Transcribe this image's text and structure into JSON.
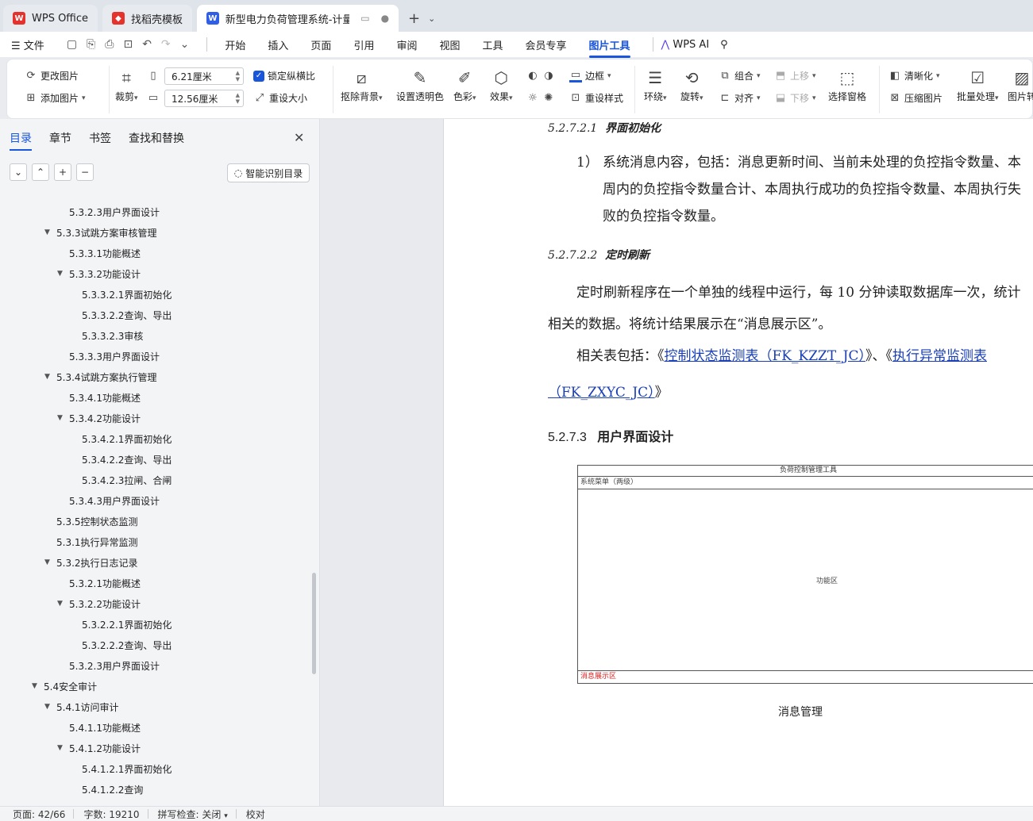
{
  "tabs": [
    {
      "label": "WPS Office",
      "icon": "wps-logo-icon",
      "color": "#e5322d"
    },
    {
      "label": "找稻壳模板",
      "icon": "docer-logo-icon",
      "color": "#e5322d"
    },
    {
      "label": "新型电力负荷管理系统-计量部",
      "icon": "wps-writer-icon",
      "color": "#2f5fe6",
      "active": true
    }
  ],
  "menu": {
    "file": "文件",
    "items": [
      "开始",
      "插入",
      "页面",
      "引用",
      "审阅",
      "视图",
      "工具",
      "会员专享",
      "图片工具"
    ],
    "active": "图片工具",
    "wps_ai": "WPS AI"
  },
  "ribbon": {
    "change_image": "更改图片",
    "add_image": "添加图片",
    "crop": "裁剪",
    "width_value": "6.21厘米",
    "height_value": "12.56厘米",
    "lock_ratio": "锁定纵横比",
    "resize": "重设大小",
    "remove_bg": "抠除背景",
    "set_transparent": "设置透明色",
    "color": "色彩",
    "effect": "效果",
    "border": "边框",
    "reset_style": "重设样式",
    "wrap": "环绕",
    "rotate": "旋转",
    "group": "组合",
    "align": "对齐",
    "move_up": "上移",
    "move_down": "下移",
    "select_pane": "选择窗格",
    "sharpen": "清晰化",
    "compress": "压缩图片",
    "batch": "批量处理",
    "image_more": "图片转"
  },
  "left_panel": {
    "tabs": [
      "目录",
      "章节",
      "书签",
      "查找和替换"
    ],
    "active_tab": "目录",
    "ai_toc": "智能识别目录",
    "toc": [
      {
        "label": "5.3.2.3用户界面设计",
        "level": 2,
        "arrow": false
      },
      {
        "label": "5.3.3试跳方案审核管理",
        "level": 1,
        "arrow": true
      },
      {
        "label": "5.3.3.1功能概述",
        "level": 2,
        "arrow": false
      },
      {
        "label": "5.3.3.2功能设计",
        "level": 2,
        "arrow": true
      },
      {
        "label": "5.3.3.2.1界面初始化",
        "level": 3,
        "arrow": false
      },
      {
        "label": "5.3.3.2.2查询、导出",
        "level": 3,
        "arrow": false
      },
      {
        "label": "5.3.3.2.3审核",
        "level": 3,
        "arrow": false
      },
      {
        "label": "5.3.3.3用户界面设计",
        "level": 2,
        "arrow": false
      },
      {
        "label": "5.3.4试跳方案执行管理",
        "level": 1,
        "arrow": true
      },
      {
        "label": "5.3.4.1功能概述",
        "level": 2,
        "arrow": false
      },
      {
        "label": "5.3.4.2功能设计",
        "level": 2,
        "arrow": true
      },
      {
        "label": "5.3.4.2.1界面初始化",
        "level": 3,
        "arrow": false
      },
      {
        "label": "5.3.4.2.2查询、导出",
        "level": 3,
        "arrow": false
      },
      {
        "label": "5.3.4.2.3拉闸、合闸",
        "level": 3,
        "arrow": false
      },
      {
        "label": "5.3.4.3用户界面设计",
        "level": 2,
        "arrow": false
      },
      {
        "label": "5.3.5控制状态监测",
        "level": 1,
        "arrow": false
      },
      {
        "label": "5.3.1执行异常监测",
        "level": 1,
        "arrow": false
      },
      {
        "label": "5.3.2执行日志记录",
        "level": 1,
        "arrow": true
      },
      {
        "label": "5.3.2.1功能概述",
        "level": 2,
        "arrow": false
      },
      {
        "label": "5.3.2.2功能设计",
        "level": 2,
        "arrow": true
      },
      {
        "label": "5.3.2.2.1界面初始化",
        "level": 3,
        "arrow": false
      },
      {
        "label": "5.3.2.2.2查询、导出",
        "level": 3,
        "arrow": false
      },
      {
        "label": "5.3.2.3用户界面设计",
        "level": 2,
        "arrow": false
      },
      {
        "label": "5.4安全审计",
        "level": 0,
        "arrow": true
      },
      {
        "label": "5.4.1访问审计",
        "level": 1,
        "arrow": true
      },
      {
        "label": "5.4.1.1功能概述",
        "level": 2,
        "arrow": false
      },
      {
        "label": "5.4.1.2功能设计",
        "level": 2,
        "arrow": true
      },
      {
        "label": "5.4.1.2.1界面初始化",
        "level": 3,
        "arrow": false
      },
      {
        "label": "5.4.1.2.2查询",
        "level": 3,
        "arrow": false
      }
    ]
  },
  "document": {
    "h_init_num": "5.2.7.2.1",
    "h_init_title": "界面初始化",
    "list_marker": "1）",
    "list_line1": "系统消息内容，包括：消息更新时间、当前未处理的负控指令数量、本",
    "list_line2": "周内的负控指令数量合计、本周执行成功的负控指令数量、本周执行失",
    "list_line3": "败的负控指令数量。",
    "h_refresh_num": "5.2.7.2.2",
    "h_refresh_title": "定时刷新",
    "p1_line1": "定时刷新程序在一个单独的线程中运行，每 10 分钟读取数据库一次，统计",
    "p1_line2": "相关的数据。将统计结果展示在“消息展示区”。",
    "p2_prefix": "相关表包括：《",
    "p2_link1": "控制状态监测表（FK_KZZT_JC）",
    "p2_mid": "》、《",
    "p2_link2_a": "执行异常监测表",
    "p2_link2_b": "（FK_ZXYC_JC）",
    "p2_suffix": "》",
    "h3_num": "5.2.7.3",
    "h3_title": "用户界面设计",
    "figure": {
      "title": "负荷控制管理工具",
      "menu": "系统菜单（两级）",
      "func": "功能区",
      "msg": "消息展示区"
    },
    "caption": "消息管理"
  },
  "status": {
    "page": "页面: 42/66",
    "words": "字数: 19210",
    "spell": "拼写检查: 关闭",
    "proof": "校对"
  }
}
